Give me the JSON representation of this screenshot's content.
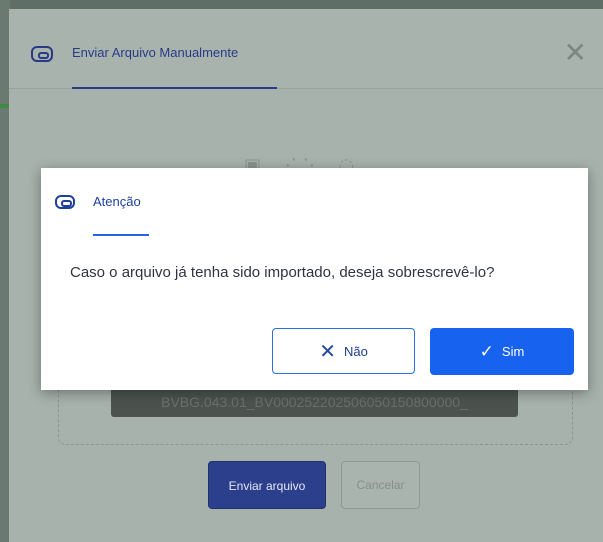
{
  "outer_modal": {
    "title": "Enviar Arquivo Manualmente",
    "close_icon": "close-icon",
    "filename": "BVBG.043.01_BV000252202506050150800000_",
    "send_button": "Enviar arquivo",
    "cancel_button": "Cancelar"
  },
  "dialog": {
    "title": "Atenção",
    "message": "Caso o arquivo já tenha sido importado, deseja sobrescrevê-lo?",
    "no_label": "Não",
    "yes_label": "Sim"
  },
  "colors": {
    "accent": "#1862f0",
    "title_blue": "#1f3f9e",
    "overlay": "#5f6f66"
  }
}
